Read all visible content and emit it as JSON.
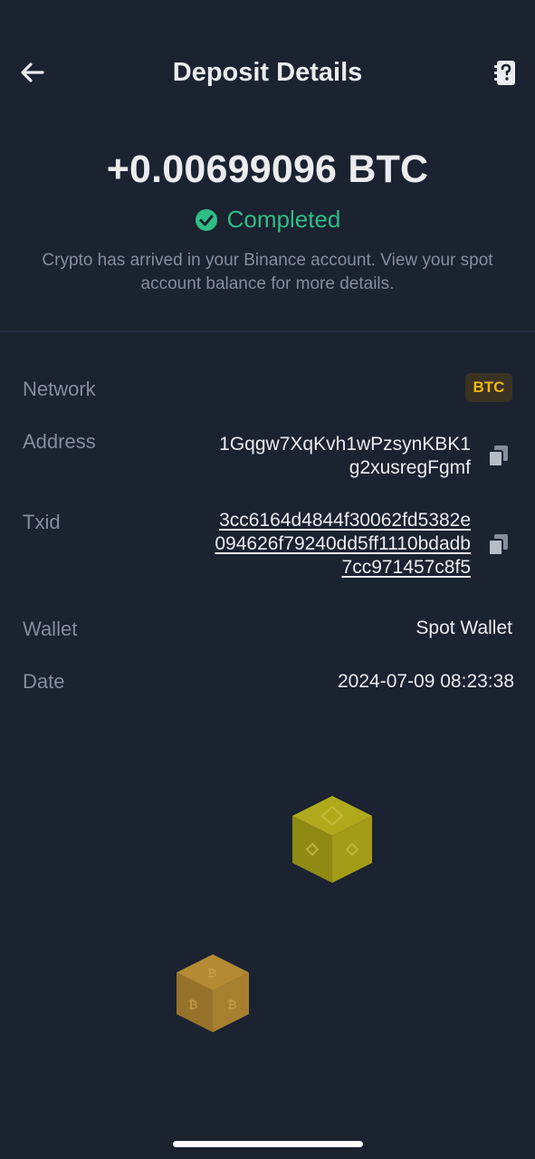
{
  "header": {
    "title": "Deposit Details",
    "back_icon": "arrow-left-icon",
    "help_icon": "help-document-icon"
  },
  "summary": {
    "amount": "+0.00699096 BTC",
    "status": "Completed",
    "status_color": "#2ebd85",
    "description": "Crypto has arrived in your Binance account. View your spot account balance for more details."
  },
  "details": {
    "network": {
      "label": "Network",
      "value": "BTC"
    },
    "address": {
      "label": "Address",
      "line1": "1Gqgw7XqKvh1wPzsynKBK1",
      "line2": "g2xusregFgmf"
    },
    "txid": {
      "label": "Txid",
      "line1": "3cc6164d4844f30062fd5382e",
      "line2": "094626f79240dd5ff1110bdadb",
      "line3": "7cc971457c8f5"
    },
    "wallet": {
      "label": "Wallet",
      "value": "Spot Wallet"
    },
    "date": {
      "label": "Date",
      "value": "2024-07-09 08:23:38"
    }
  },
  "colors": {
    "background": "#1b2230",
    "accent": "#f0b90b",
    "text_secondary": "#848e9c"
  }
}
